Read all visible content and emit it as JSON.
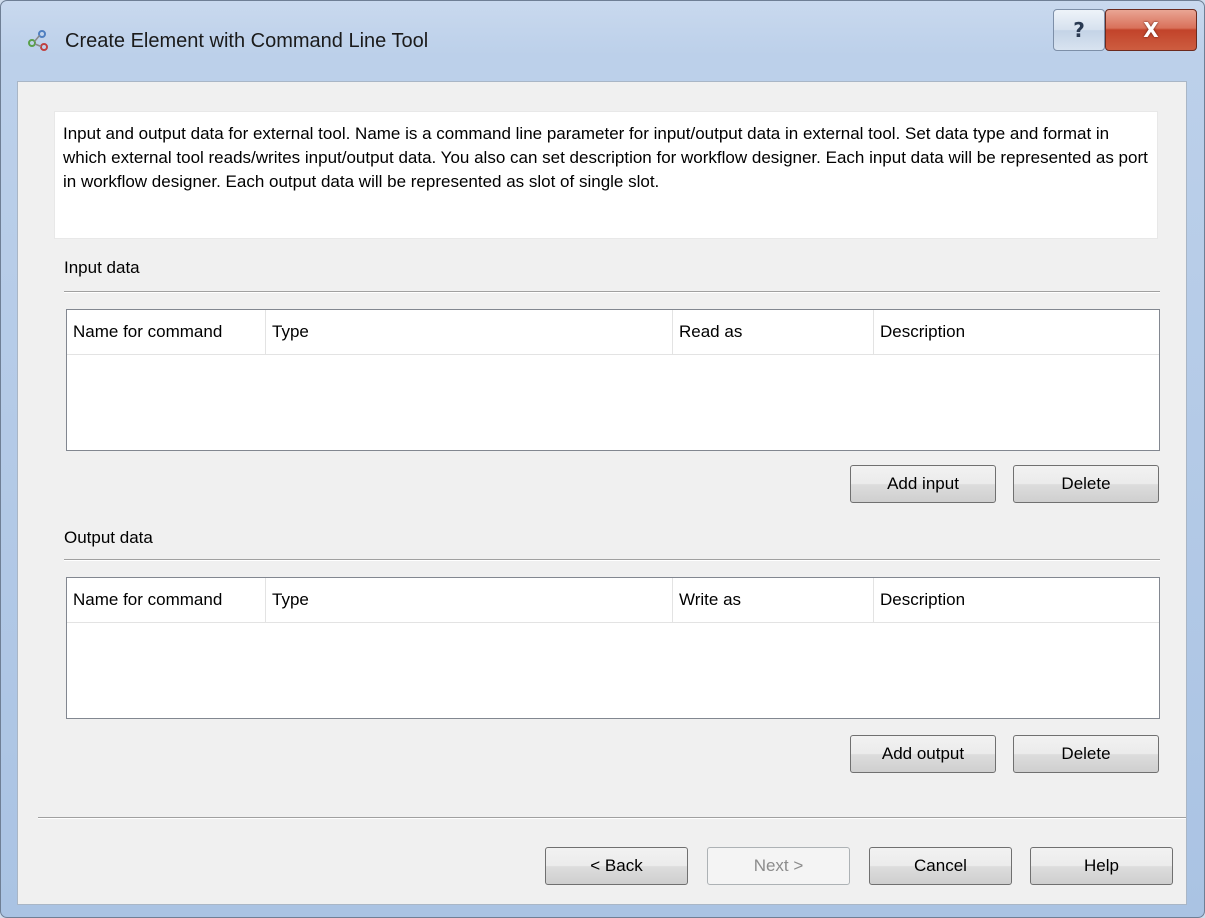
{
  "window": {
    "title": "Create Element with Command Line Tool",
    "help_button": "?",
    "close_button": "X"
  },
  "description": "Input and output data for external tool. Name is  a command line parameter for input/output data in external tool. Set data type and format in which external tool reads/writes input/output data. You also can set description for workflow designer. Each input data will be represented as port in workflow designer. Each output data will be represented as slot of single slot.",
  "input_section": {
    "label": "Input data",
    "columns": [
      "Name for command",
      "Type",
      "Read as",
      "Description"
    ],
    "add_button": "Add input",
    "delete_button": "Delete"
  },
  "output_section": {
    "label": "Output data",
    "columns": [
      "Name for command",
      "Type",
      "Write as",
      "Description"
    ],
    "add_button": "Add output",
    "delete_button": "Delete"
  },
  "footer": {
    "back": "< Back",
    "next": "Next >",
    "cancel": "Cancel",
    "help": "Help"
  }
}
